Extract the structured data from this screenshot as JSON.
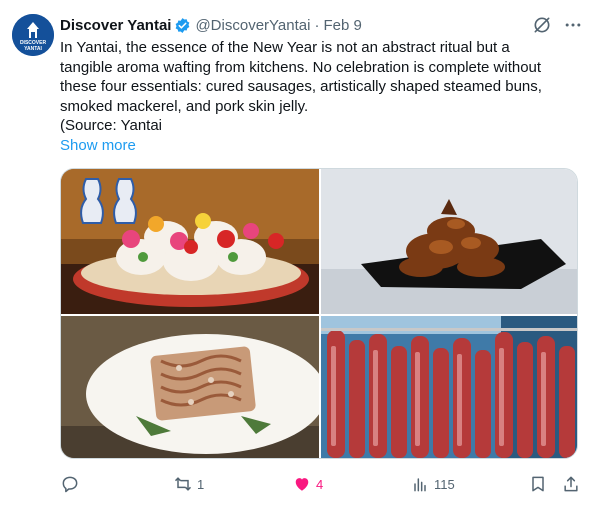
{
  "tweet": {
    "author_name": "Discover Yantai",
    "handle": "@DiscoverYantai",
    "separator": "·",
    "date": "Feb 9",
    "text": "In Yantai, the essence of the New Year is not an abstract ritual but a\ntangible aroma wafting from kitchens. No celebration is complete without\nthese four essentials: cured sausages, artistically shaped steamed buns,\nsmoked mackerel, and pork skin jelly.\n(Source: Yantai",
    "show_more": "Show more"
  },
  "avatar": {
    "logo_line1": "DISCOVER",
    "logo_line2": "YANTAI"
  },
  "actions": {
    "reply_count": "",
    "retweet_count": "1",
    "like_count": "4",
    "views_count": "115"
  },
  "icons": {
    "verified": "verified-badge-icon",
    "grok": "grok-icon",
    "more": "more-icon",
    "reply": "reply-icon",
    "retweet": "retweet-icon",
    "like": "heart-icon",
    "views": "views-icon",
    "bookmark": "bookmark-icon",
    "share": "share-icon"
  },
  "colors": {
    "accent": "#1d9bf0",
    "like": "#f91880",
    "muted": "#536471",
    "text": "#0f1419",
    "brand": "#14509a"
  }
}
